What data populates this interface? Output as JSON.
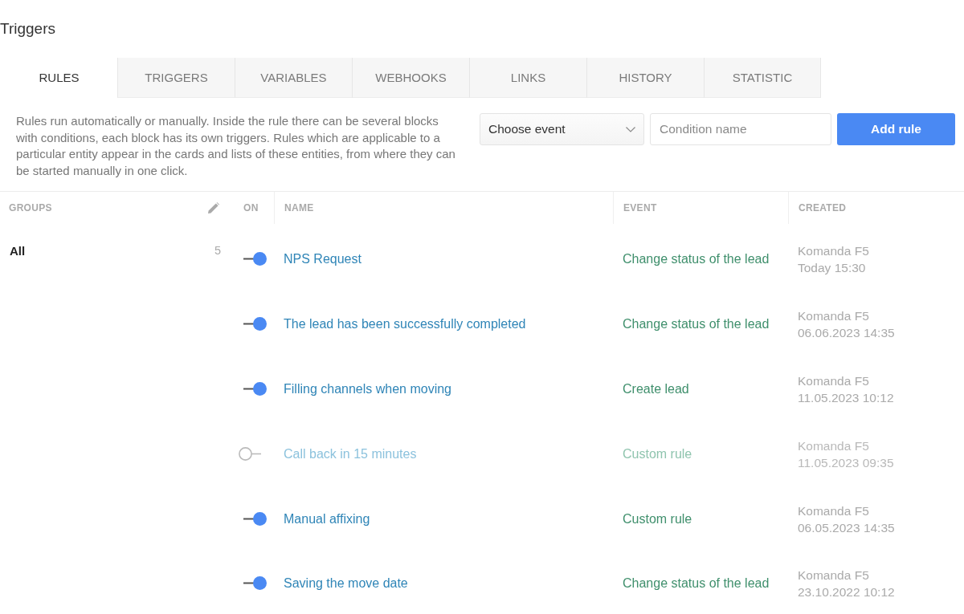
{
  "page": {
    "title": "Triggers"
  },
  "tabs": [
    {
      "label": "RULES",
      "selected": true
    },
    {
      "label": "TRIGGERS",
      "selected": false
    },
    {
      "label": "VARIABLES",
      "selected": false
    },
    {
      "label": "WEBHOOKS",
      "selected": false
    },
    {
      "label": "LINKS",
      "selected": false
    },
    {
      "label": "HISTORY",
      "selected": false
    },
    {
      "label": "STATISTIC",
      "selected": false
    }
  ],
  "description": "Rules run automatically or manually. Inside the rule there can be several blocks with conditions, each block has its own triggers. Rules which are applicable to a particular entity appear in the cards and lists of these entities, from where they can be started manually in one click.",
  "event_select": {
    "value": "Choose event"
  },
  "condition_field": {
    "placeholder": "Condition name"
  },
  "add_button": {
    "label": "Add rule"
  },
  "groups_panel": {
    "heading": "GROUPS",
    "groups": [
      {
        "label": "All",
        "count": "5",
        "selected": true
      }
    ]
  },
  "table": {
    "columns": [
      "ON",
      "NAME",
      "EVENT",
      "CREATED"
    ],
    "rules": [
      {
        "on": true,
        "name": "NPS Request",
        "event": "Change status of the lead",
        "author": "Komanda F5",
        "created": "Today 15:30"
      },
      {
        "on": true,
        "name": "The lead has been successfully completed",
        "event": "Change status of the lead",
        "author": "Komanda F5",
        "created": "06.06.2023 14:35"
      },
      {
        "on": true,
        "name": "Filling channels when moving",
        "event": "Create lead",
        "author": "Komanda F5",
        "created": "11.05.2023 10:12"
      },
      {
        "on": false,
        "name": "Call back in 15 minutes",
        "event": "Custom rule",
        "author": "Komanda F5",
        "created": "11.05.2023 09:35"
      },
      {
        "on": true,
        "name": "Manual affixing",
        "event": "Custom rule",
        "author": "Komanda F5",
        "created": "06.05.2023 14:35"
      },
      {
        "on": true,
        "name": "Saving the move date",
        "event": "Change status of the lead",
        "author": "Komanda F5",
        "created": "23.10.2022 10:12"
      }
    ]
  }
}
